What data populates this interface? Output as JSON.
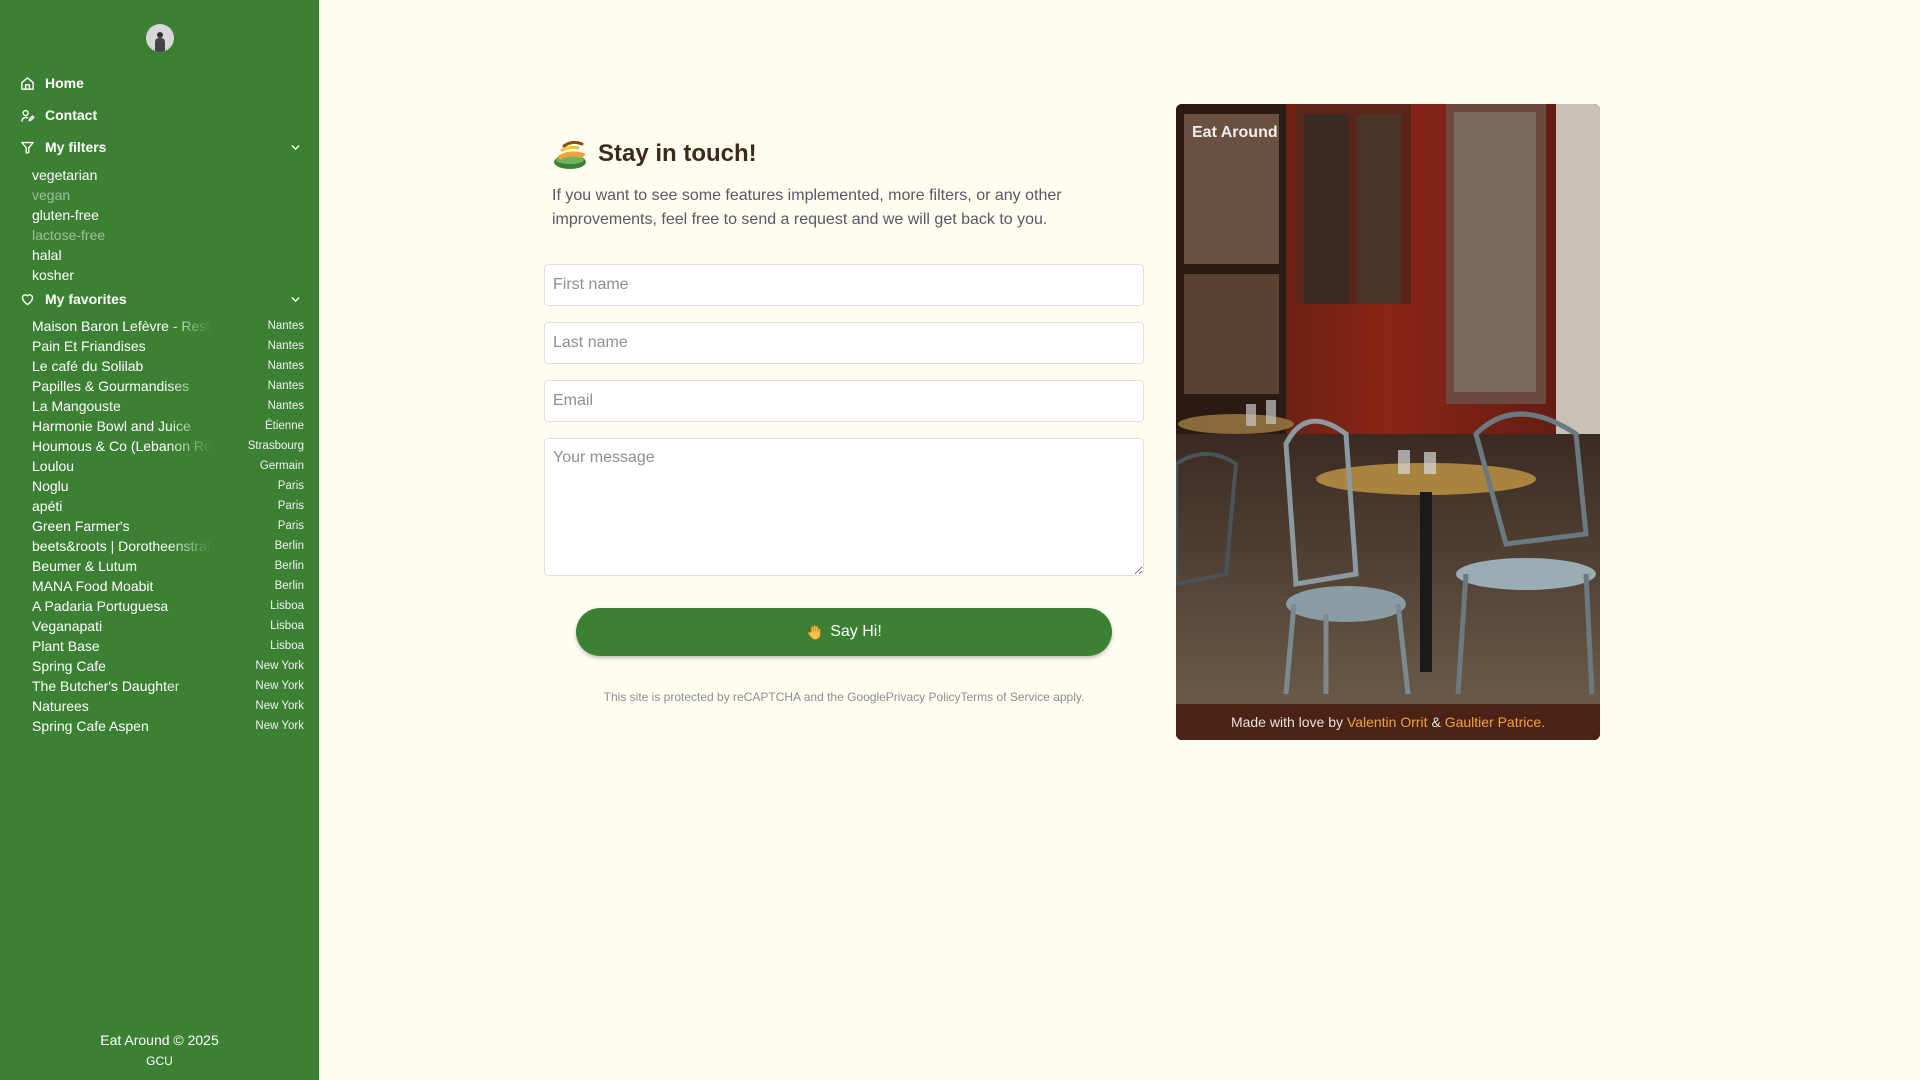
{
  "sidebar": {
    "nav": [
      {
        "label": "Home",
        "icon": "home-icon"
      },
      {
        "label": "Contact",
        "icon": "user-edit-icon"
      }
    ],
    "filters_section": {
      "label": "My filters",
      "icon": "filter-icon"
    },
    "filters": [
      {
        "label": "vegetarian",
        "active": true
      },
      {
        "label": "vegan",
        "active": false
      },
      {
        "label": "gluten-free",
        "active": true
      },
      {
        "label": "lactose-free",
        "active": false
      },
      {
        "label": "halal",
        "active": true
      },
      {
        "label": "kosher",
        "active": true
      }
    ],
    "favorites_section": {
      "label": "My favorites",
      "icon": "heart-icon"
    },
    "favorites": [
      {
        "name": "Maison Baron Lefèvre - Restaurant",
        "city": "Nantes"
      },
      {
        "name": "Pain Et Friandises",
        "city": "Nantes"
      },
      {
        "name": "Le café du Solilab",
        "city": "Nantes"
      },
      {
        "name": "Papilles & Gourmandises",
        "city": "Nantes"
      },
      {
        "name": "La Mangouste",
        "city": "Nantes"
      },
      {
        "name": "Harmonie Bowl and Juice",
        "city": "Étienne"
      },
      {
        "name": "Houmous & Co (Lebanon Restaurant)",
        "city": "Strasbourg"
      },
      {
        "name": "Loulou",
        "city": "Germain"
      },
      {
        "name": "Noglu",
        "city": "Paris"
      },
      {
        "name": "apéti",
        "city": "Paris"
      },
      {
        "name": "Green Farmer's",
        "city": "Paris"
      },
      {
        "name": "beets&roots | Dorotheenstraße",
        "city": "Berlin"
      },
      {
        "name": "Beumer & Lutum",
        "city": "Berlin"
      },
      {
        "name": "MANA Food Moabit",
        "city": "Berlin"
      },
      {
        "name": "A Padaria Portuguesa",
        "city": "Lisboa"
      },
      {
        "name": "Veganapati",
        "city": "Lisboa"
      },
      {
        "name": "Plant Base",
        "city": "Lisboa"
      },
      {
        "name": "Spring Cafe",
        "city": "New York"
      },
      {
        "name": "The Butcher's Daughter",
        "city": "New York"
      },
      {
        "name": "Naturees",
        "city": "New York"
      },
      {
        "name": "Spring Cafe Aspen",
        "city": "New York"
      }
    ],
    "footer": {
      "copyright": "Eat Around © 2025",
      "gcu": "GCU"
    }
  },
  "contact": {
    "title": "Stay in touch!",
    "intro": "If you want to see some features implemented, more filters, or any other improvements, feel free to send a request and we will get back to you.",
    "first_name_placeholder": "First name",
    "last_name_placeholder": "Last name",
    "email_placeholder": "Email",
    "message_placeholder": "Your message",
    "submit_label": "Say Hi!",
    "recaptcha": {
      "prefix": "This site is protected by reCAPTCHA and the Google",
      "privacy": "Privacy Policy",
      "terms": "Terms of Service",
      "suffix": "apply."
    }
  },
  "card": {
    "title": "Eat Around",
    "footer_prefix": "Made with love by",
    "author1": "Valentin Orrit",
    "separator": "&",
    "author2": "Gaultier Patrice."
  },
  "colors": {
    "sidebar": "#3b8033",
    "background": "#fffdf0",
    "accent": "#f2a23c"
  }
}
